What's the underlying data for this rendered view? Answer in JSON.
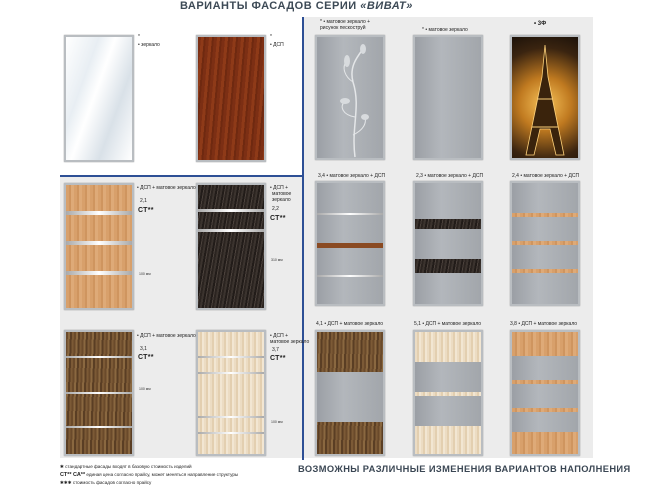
{
  "header": {
    "title": "ВАРИАНТЫ ФАСАДОВ СЕРИИ",
    "series": "«ВИВАТ»"
  },
  "doors": {
    "mirror": {
      "label": "• зеркало",
      "mark": "*"
    },
    "dsp": {
      "label": "• ДСП",
      "mark": "*"
    },
    "frost_pattern": {
      "label_line1": "* • матовое зеркало +",
      "label_line2": "рисунок пескоструй"
    },
    "frost_plain": {
      "label": "* • матовое зеркало"
    },
    "photo_3f": {
      "label": "• 3Ф"
    },
    "frost_34": {
      "label": "3,4 • матовое зеркало + ДСП"
    },
    "frost_23": {
      "label": "2,3 • матовое зеркало + ДСП"
    },
    "frost_24": {
      "label": "2,4 • матовое зеркало + ДСП"
    },
    "frost_41": {
      "label": "4,1 • ДСП + матовое зеркало"
    },
    "frost_51": {
      "label": "5,1 • ДСП + матовое зеркало"
    },
    "frost_38": {
      "label": "3,8 • ДСП + матовое зеркало"
    },
    "light_21": {
      "label": "• ДСП + матовое зеркало",
      "code": "2,1",
      "ct": "СТ**",
      "dim": "100 мм"
    },
    "dark_22": {
      "label_line1": "• ДСП +",
      "label_line2": "матовое",
      "label_line3": "зеркало",
      "code": "2,2",
      "ct": "СТ**",
      "dim": "310 мм"
    },
    "walnut_31": {
      "label": "• ДСП + матовое зеркало",
      "code": "3,1",
      "ct": "СТ**",
      "dim": "100 мм"
    },
    "ash_37": {
      "label_line1": "• ДСП +",
      "label_line2": "матовое зеркало",
      "code": "3,7",
      "ct": "СТ**",
      "dim": "100 мм"
    }
  },
  "footer": {
    "line1": "✱  стандартные фасады входят в базовую стоимость изделий",
    "line2_mark": "СТ**  СА**",
    "line2_text": " единая цена согласно прайсу, может меняться направление структуры",
    "line3": "✱✱✱  стоимость фасадов согласно прайсу",
    "note": "ВОЗМОЖНЫ РАЗЛИЧНЫЕ ИЗМЕНЕНИЯ ВАРИАНТОВ НАПОЛНЕНИЯ"
  },
  "colors": {
    "divider": "#2d4f95",
    "section_bg": "#ececec",
    "header_text": "#3d4a56"
  }
}
